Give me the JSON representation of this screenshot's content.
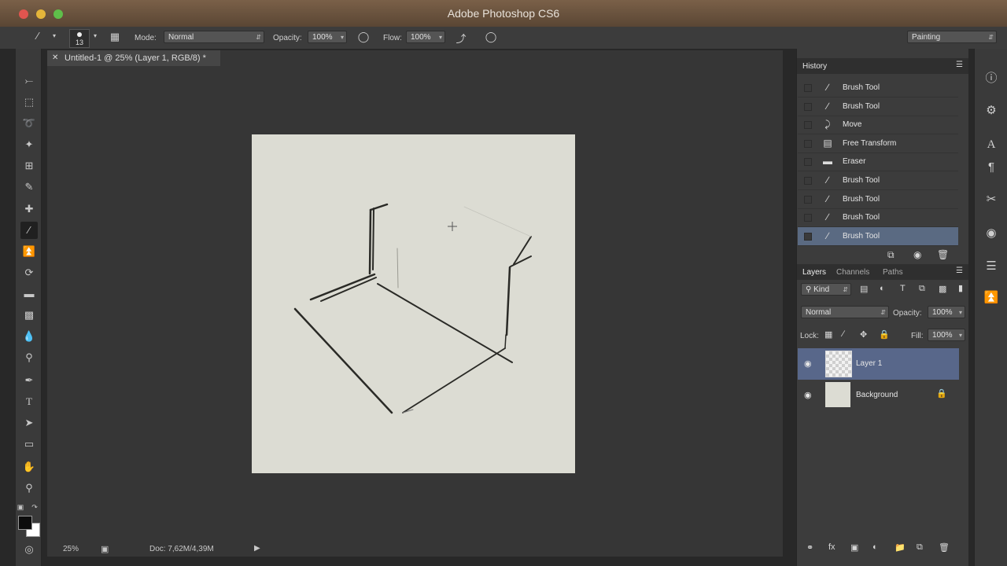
{
  "window": {
    "title": "Adobe Photoshop CS6"
  },
  "options": {
    "brush_size": "13",
    "mode_label": "Mode:",
    "mode_value": "Normal",
    "opacity_label": "Opacity:",
    "opacity_value": "100%",
    "flow_label": "Flow:",
    "flow_value": "100%",
    "workspace_value": "Painting"
  },
  "document": {
    "tab_title": "Untitled-1 @ 25% (Layer 1, RGB/8) *",
    "zoom": "25%",
    "doc_info": "Doc: 7,62M/4,39M"
  },
  "history": {
    "title": "History",
    "items": [
      {
        "label": "Brush Tool",
        "icon": "brush-icon"
      },
      {
        "label": "Brush Tool",
        "icon": "brush-icon"
      },
      {
        "label": "Move",
        "icon": "move-icon"
      },
      {
        "label": "Free Transform",
        "icon": "free-transform-icon"
      },
      {
        "label": "Eraser",
        "icon": "eraser-icon"
      },
      {
        "label": "Brush Tool",
        "icon": "brush-icon"
      },
      {
        "label": "Brush Tool",
        "icon": "brush-icon"
      },
      {
        "label": "Brush Tool",
        "icon": "brush-icon"
      },
      {
        "label": "Brush Tool",
        "icon": "brush-icon"
      }
    ]
  },
  "layers_panel": {
    "tabs": [
      "Layers",
      "Channels",
      "Paths"
    ],
    "filter_kind": "Kind",
    "blend_mode": "Normal",
    "opacity_label": "Opacity:",
    "opacity_value": "100%",
    "lock_label": "Lock:",
    "fill_label": "Fill:",
    "fill_value": "100%",
    "layers": [
      {
        "name": "Layer 1",
        "selected": true
      },
      {
        "name": "Background",
        "locked": true
      }
    ]
  },
  "colors": {
    "foreground": "#0c0c0c",
    "background": "#ffffff"
  }
}
